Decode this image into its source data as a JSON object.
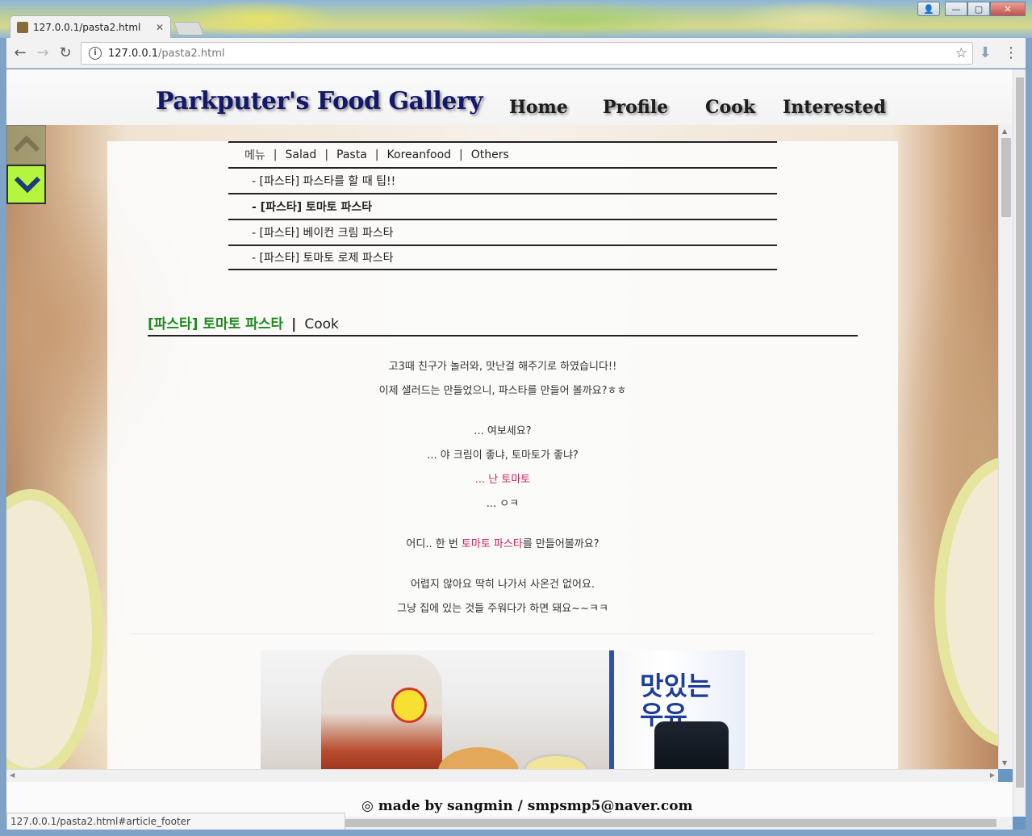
{
  "browser": {
    "tab_title": "127.0.0.1/pasta2.html",
    "tab_close": "✕",
    "url_host": "127.0.0.1",
    "url_path": "/pasta2.html",
    "status_url": "127.0.0.1/pasta2.html#article_footer",
    "window_buttons": {
      "user": "👤",
      "minimize": "—",
      "maximize": "▢",
      "close": "✕"
    },
    "nav": {
      "back": "←",
      "forward": "→",
      "reload": "↻",
      "download": "⬇",
      "menu": "⋮",
      "star": "☆",
      "info": "i"
    }
  },
  "site": {
    "title": "Parkputer's Food Gallery",
    "nav": [
      "Home",
      "Profile",
      "Cook",
      "Interested"
    ]
  },
  "submenu": {
    "label": "메뉴",
    "categories": [
      "Salad",
      "Pasta",
      "Koreanfood",
      "Others"
    ],
    "items": [
      "- [파스타] 파스타를 할 때 팁!!",
      "- [파스타] 토마토 파스타",
      "- [파스타] 베이컨 크림 파스타",
      "- [파스타] 토마토 로제 파스타"
    ],
    "active_index": 1
  },
  "article": {
    "category": "[파스타] 토마토 파스타",
    "section": "Cook",
    "lines": {
      "l1": "고3때 친구가 놀러와, 맛난걸 해주기로 하였습니다!!",
      "l2": "이제 샐러드는 만들었으니, 파스타를 만들어 볼까요?ㅎㅎ",
      "l3": "... 여보세요?",
      "l4": "... 야 크림이 좋냐, 토마토가 좋냐?",
      "l5": "... 난 토마토",
      "l6": "... ㅇㅋ",
      "l7a": "어디.. 한 번 ",
      "l7b": "토마토 파스타",
      "l7c": "를 만들어볼까요?",
      "l8": "어렵지 않아요 딱히 나가서 사온건 없어요.",
      "l9": "그냥 집에 있는 것들 주워다가 하면 돼요~~ㅋㅋ"
    },
    "photo_text": "맛있는\n우유"
  },
  "footer": {
    "text": "◎  made by sangmin  /  smpsmp5@naver.com"
  }
}
